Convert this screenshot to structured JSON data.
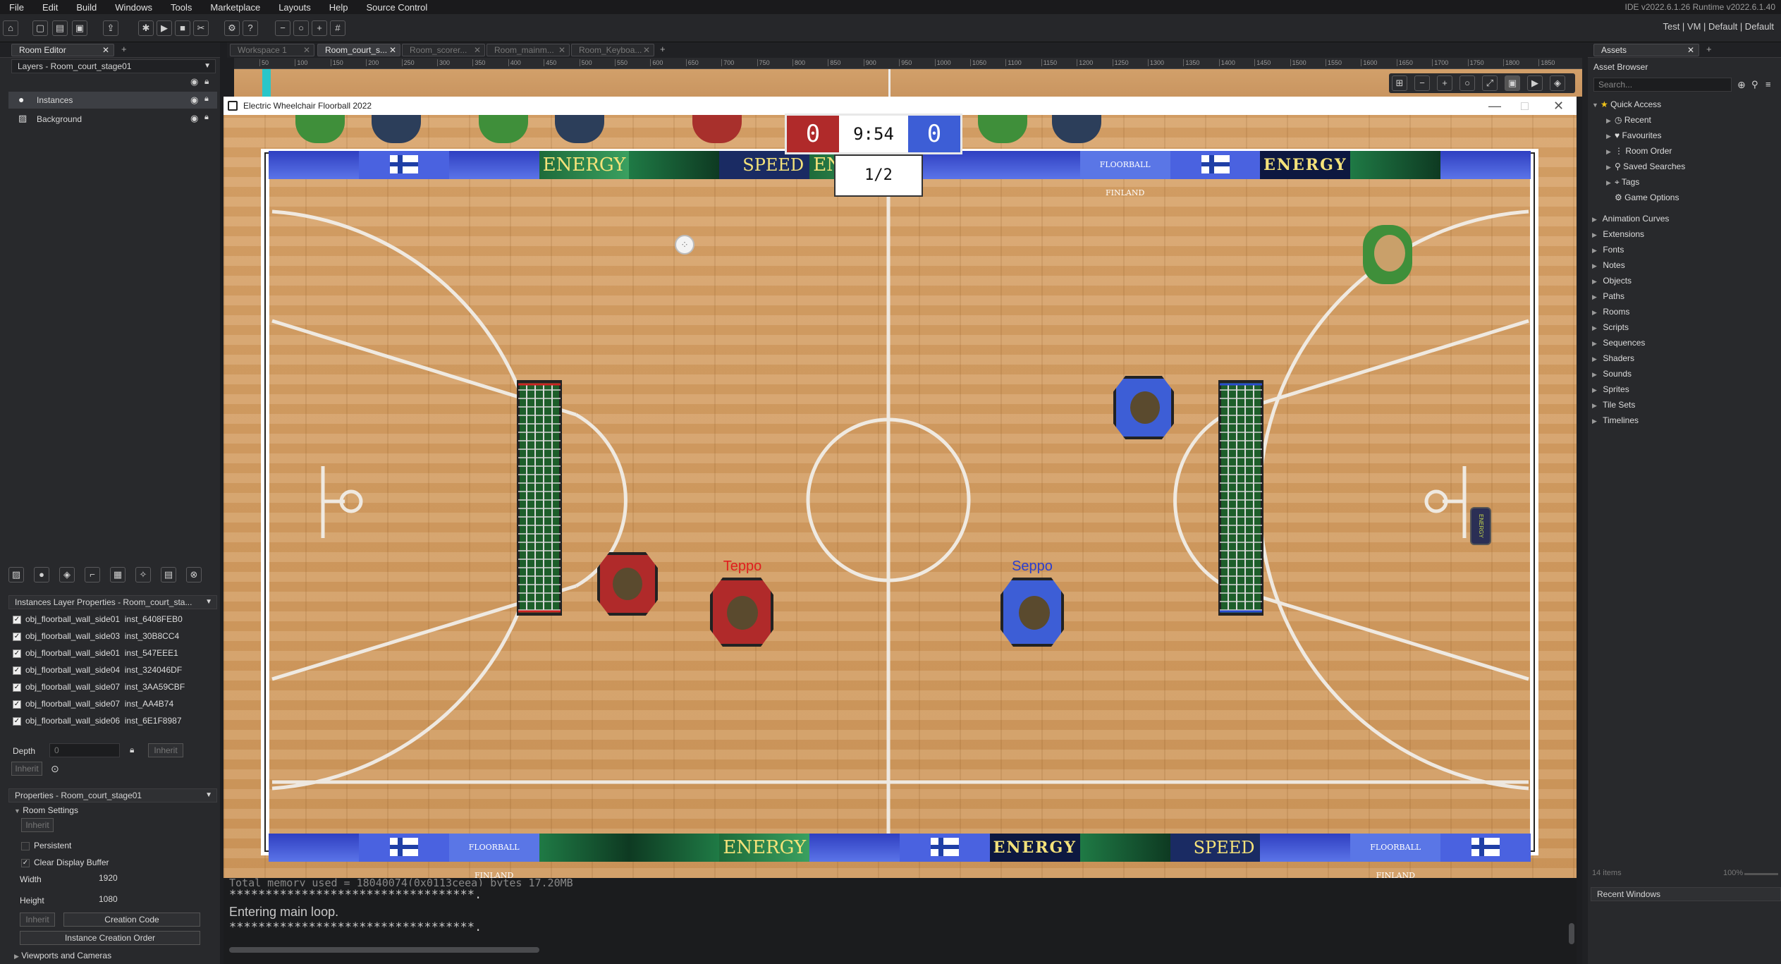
{
  "menu": [
    "File",
    "Edit",
    "Build",
    "Windows",
    "Tools",
    "Marketplace",
    "Layouts",
    "Help",
    "Source Control"
  ],
  "version": "IDE v2022.6.1.26  Runtime v2022.6.1.40",
  "toolbar_right": "Test  |  VM  |  Default  |  Default",
  "room_editor": {
    "tab": "Room Editor",
    "layers_dropdown": "Layers - Room_court_stage01",
    "layers": [
      "Instances",
      "Background"
    ],
    "instances_header": "Instances Layer Properties - Room_court_sta...",
    "instances": [
      {
        "obj": "obj_floorball_wall_side01",
        "inst": "inst_6408FEB0"
      },
      {
        "obj": "obj_floorball_wall_side03",
        "inst": "inst_30B8CC4"
      },
      {
        "obj": "obj_floorball_wall_side01",
        "inst": "inst_547EEE1"
      },
      {
        "obj": "obj_floorball_wall_side04",
        "inst": "inst_324046DF"
      },
      {
        "obj": "obj_floorball_wall_side07",
        "inst": "inst_3AA59CBF"
      },
      {
        "obj": "obj_floorball_wall_side07",
        "inst": "inst_AA4B74"
      },
      {
        "obj": "obj_floorball_wall_side06",
        "inst": "inst_6E1F8987"
      }
    ],
    "depth_label": "Depth",
    "depth_value": "0",
    "inherit": "Inherit",
    "properties_header": "Properties - Room_court_stage01",
    "room_settings": "Room Settings",
    "persistent": "Persistent",
    "clear_display": "Clear Display Buffer",
    "width_label": "Width",
    "width_value": "1920",
    "height_label": "Height",
    "height_value": "1080",
    "creation_code": "Creation Code",
    "instance_creation_order": "Instance Creation Order",
    "viewports": "Viewports and Cameras"
  },
  "doc_tabs": [
    "Workspace 1",
    "Room_court_s...",
    "Room_scorer...",
    "Room_mainm...",
    "Room_Keyboa..."
  ],
  "ruler": [
    "50",
    "100",
    "150",
    "200",
    "250",
    "300",
    "350",
    "400",
    "450",
    "500",
    "550",
    "600",
    "650",
    "700",
    "750",
    "800",
    "850",
    "900",
    "950",
    "1000",
    "1050",
    "1100",
    "1150",
    "1200",
    "1250",
    "1300",
    "1350",
    "1400",
    "1450",
    "1500",
    "1550",
    "1600",
    "1650",
    "1700",
    "1750",
    "1800",
    "1850"
  ],
  "game": {
    "title": "Electric Wheelchair Floorball 2022",
    "score_left": "0",
    "score_right": "0",
    "timer": "9:54",
    "period": "1/2",
    "player1": "Teppo",
    "player2": "Seppo",
    "ads_top": [
      "ENERGY",
      "SPEED",
      "ENERGY",
      "FLOORBALL FINLAND",
      "ENERGY"
    ],
    "ads_bottom": [
      "FLOORBALL FINLAND",
      "ENERGY",
      "ENERGY",
      "SPEED",
      "FLOORBALL FINLAND"
    ],
    "can_label": "ENERGY"
  },
  "console": {
    "line1": "Total memory used = 18040074(0x0113ceea) bytes 17.20MB",
    "line2": "**********************************.",
    "line3": "Entering main loop.",
    "line4": "**********************************."
  },
  "assets": {
    "tab": "Assets",
    "browser": "Asset Browser",
    "search_placeholder": "Search...",
    "quick_access": "Quick Access",
    "quick_items": [
      "Recent",
      "Favourites",
      "Room Order",
      "Saved Searches",
      "Tags",
      "Game Options"
    ],
    "folders": [
      "Animation Curves",
      "Extensions",
      "Fonts",
      "Notes",
      "Objects",
      "Paths",
      "Rooms",
      "Scripts",
      "Sequences",
      "Shaders",
      "Sounds",
      "Sprites",
      "Tile Sets",
      "Timelines"
    ],
    "items_count": "14 items",
    "zoom": "100%",
    "recent_windows": "Recent Windows"
  },
  "colors": {
    "team_red": "#b02a2a",
    "team_blue": "#3d5ed6",
    "accent": "#f0c419"
  }
}
